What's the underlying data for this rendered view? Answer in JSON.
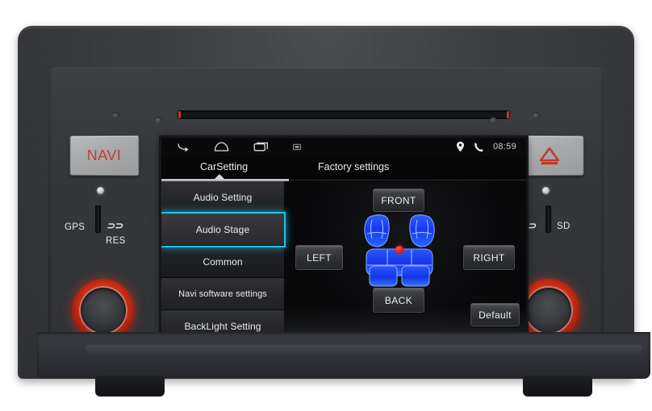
{
  "device": {
    "name": "car-head-unit",
    "left_hard_button_label": "NAVI",
    "right_hard_button_icon": "hazard-triangle-icon",
    "left_slot_label_gps": "GPS",
    "left_slot_label_res": "RES",
    "left_slot_label_sd": "SD",
    "right_slot_label_sd": "SD",
    "disc_slot_name": "disc-slot"
  },
  "screen": {
    "statusbar": {
      "nav_icons": [
        "back-icon",
        "home-icon",
        "recents-icon",
        "screenshot-icon"
      ],
      "status_icons": [
        "location-pin-icon",
        "phone-icon"
      ],
      "clock": "08:59"
    },
    "tabs": [
      {
        "label": "CarSetting",
        "active": true
      },
      {
        "label": "Factory settings",
        "active": false
      }
    ],
    "sidebar": {
      "items": [
        {
          "label": "Audio Setting",
          "selected": false
        },
        {
          "label": "Audio Stage",
          "selected": true
        },
        {
          "label": "Common",
          "selected": false
        },
        {
          "label": "Navi software settings",
          "selected": false
        },
        {
          "label": "BackLight Setting",
          "selected": false
        }
      ]
    },
    "main": {
      "title": "audio-stage-panel",
      "buttons": {
        "front": "FRONT",
        "left": "LEFT",
        "right": "RIGHT",
        "back": "BACK",
        "default": "Default"
      },
      "seat_diagram": {
        "name": "car-seat-diagram",
        "front_seats": 2,
        "rear_bench": 1,
        "stage_marker": "red-dot-position-indicator"
      }
    }
  },
  "colors": {
    "selection_cyan": "#18c6f0",
    "seat_blue": "#1b4df0",
    "accent_red": "#c0392b",
    "knob_ring_red": "#e03518",
    "screen_black": "#000000"
  }
}
